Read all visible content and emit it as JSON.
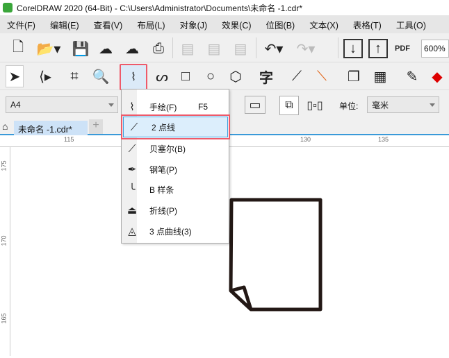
{
  "title": "CorelDRAW 2020 (64-Bit) - C:\\Users\\Administrator\\Documents\\未命名 -1.cdr*",
  "menu": [
    "文件(F)",
    "编辑(E)",
    "查看(V)",
    "布局(L)",
    "对象(J)",
    "效果(C)",
    "位图(B)",
    "文本(X)",
    "表格(T)",
    "工具(O)"
  ],
  "toolbar": {
    "zoom": "600%",
    "pdf_label": "PDF"
  },
  "toolbox": {
    "text_tool": "字"
  },
  "propbar": {
    "page_size": "A4",
    "unit_label": "单位:",
    "unit_value": "毫米"
  },
  "tab": {
    "doc": "未命名 -1.cdr*",
    "add": "+"
  },
  "ruler": {
    "h": [
      "115",
      "130",
      "135"
    ],
    "v": [
      "175",
      "170",
      "165"
    ]
  },
  "flyout": [
    {
      "label": "手绘(F)",
      "shortcut": "F5",
      "icon": "freehand-icon"
    },
    {
      "label": "2 点线",
      "icon": "two-point-line-icon",
      "selected": true
    },
    {
      "label": "贝塞尔(B)",
      "icon": "bezier-icon"
    },
    {
      "label": "钢笔(P)",
      "icon": "pen-icon"
    },
    {
      "label": "B 样条",
      "icon": "bspline-icon"
    },
    {
      "label": "折线(P)",
      "icon": "polyline-icon"
    },
    {
      "label": "3 点曲线(3)",
      "icon": "three-point-curve-icon"
    }
  ],
  "colors": {
    "accent": "#3a9ad9",
    "highlight": "#ee5a6a"
  }
}
